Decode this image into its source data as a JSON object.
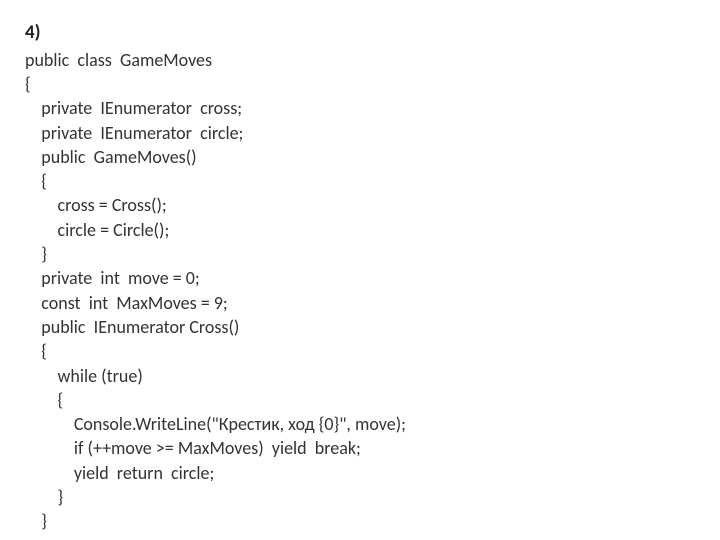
{
  "heading": "4)",
  "code": {
    "l1": "public  class  GameMoves",
    "l2": "{",
    "l3": "    private  IEnumerator  cross;",
    "l4": "    private  IEnumerator  circle;",
    "l5": "    public  GameMoves()",
    "l6": "    {",
    "l7": "        cross = Cross();",
    "l8": "        circle = Circle();",
    "l9": "    }",
    "l10": "    private  int  move = 0;",
    "l11": "    const  int  MaxMoves = 9;",
    "l12": "    public  IEnumerator Cross()",
    "l13": "    {",
    "l14": "        while (true)",
    "l15": "        {",
    "l16": "            Console.WriteLine(\"Крестик, ход {0}\", move);",
    "l17": "            if (++move >= MaxMoves)  yield  break;",
    "l18": "            yield  return  circle;",
    "l19": "        }",
    "l20": "    }"
  }
}
